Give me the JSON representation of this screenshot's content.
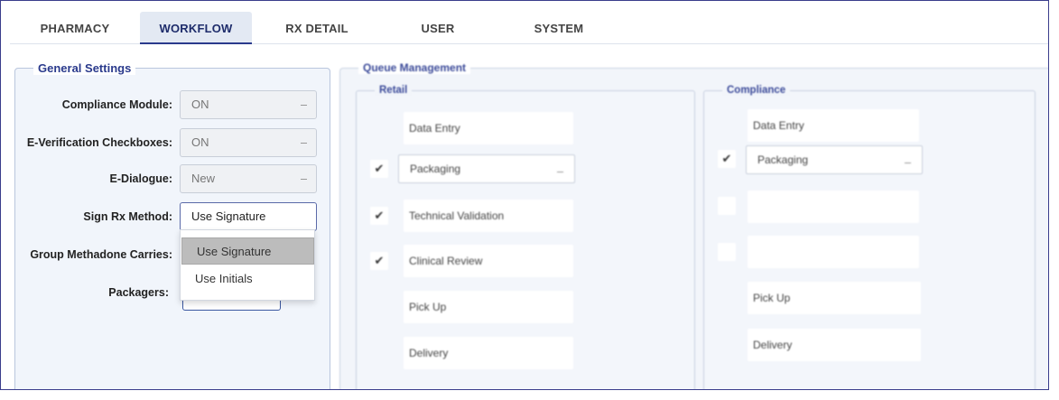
{
  "tabs": [
    {
      "label": "PHARMACY",
      "active": false
    },
    {
      "label": "WORKFLOW",
      "active": true
    },
    {
      "label": "RX DETAIL",
      "active": false
    },
    {
      "label": "USER",
      "active": false
    },
    {
      "label": "SYSTEM",
      "active": false
    }
  ],
  "general_settings": {
    "title": "General Settings",
    "compliance_module": {
      "label": "Compliance Module:",
      "value": "ON"
    },
    "e_verification": {
      "label": "E-Verification Checkboxes:",
      "value": "ON"
    },
    "e_dialogue": {
      "label": "E-Dialogue:",
      "value": "New"
    },
    "sign_rx_method": {
      "label": "Sign Rx Method:",
      "value": "Use Signature"
    },
    "group_methadone": {
      "label": "Group Methadone Carries:"
    },
    "packagers": {
      "label": "Packagers:"
    },
    "dropdown_options": [
      "Use Signature",
      "Use Initials"
    ]
  },
  "queue_management": {
    "title": "Queue Management",
    "retail": {
      "title": "Retail",
      "items": [
        {
          "label": "Data Entry",
          "checked": false,
          "dropdown": false
        },
        {
          "label": "Packaging",
          "checked": true,
          "dropdown": true
        },
        {
          "label": "Technical Validation",
          "checked": true,
          "dropdown": false
        },
        {
          "label": "Clinical Review",
          "checked": true,
          "dropdown": false
        },
        {
          "label": "Pick Up",
          "checked": false,
          "dropdown": false
        },
        {
          "label": "Delivery",
          "checked": false,
          "dropdown": false
        }
      ]
    },
    "compliance": {
      "title": "Compliance",
      "items": [
        {
          "label": "Data Entry",
          "checked": false,
          "dropdown": false
        },
        {
          "label": "Packaging",
          "checked": true,
          "dropdown": true
        },
        {
          "label": "",
          "checked": false,
          "dropdown": false
        },
        {
          "label": "",
          "checked": false,
          "dropdown": false
        },
        {
          "label": "Pick Up",
          "checked": false,
          "dropdown": false
        },
        {
          "label": "Delivery",
          "checked": false,
          "dropdown": false
        }
      ]
    }
  },
  "icons": {
    "checkmark": "check-icon",
    "caret": "chevron-down-icon"
  },
  "colors": {
    "accent": "#2a3a8c",
    "panel": "#f1f5fb",
    "highlight": "#bcbcbc"
  }
}
